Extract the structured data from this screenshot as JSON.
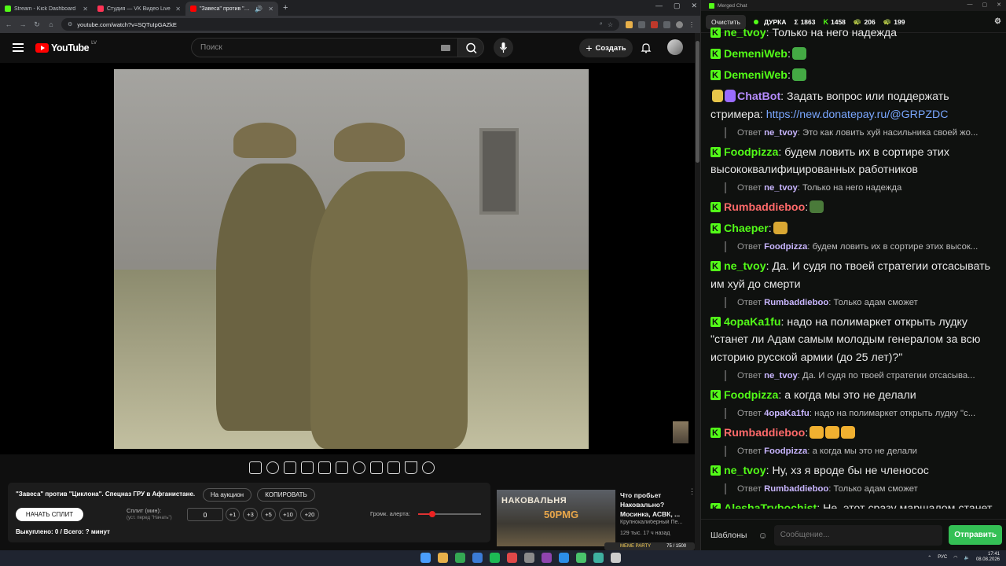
{
  "browser": {
    "tabs": [
      {
        "label": "Stream - Kick Dashboard",
        "color": "#53fc18",
        "active": false
      },
      {
        "label": "Студия — VK Видео Live",
        "color": "#ff3355",
        "active": false
      },
      {
        "label": "\"Завеса\" против \"Циклона\"...",
        "color": "#ff0000",
        "active": true
      }
    ],
    "url": "youtube.com/watch?v=SQTuIpGAZkE"
  },
  "youtube": {
    "logo_text": "YouTube",
    "country": "LV",
    "search_placeholder": "Поиск",
    "create_label": "Создать"
  },
  "panel": {
    "title": "\"Завеса\" против \"Циклона\". Спецназ ГРУ в Афганистане.",
    "auction_label": "На аукцион",
    "copy_label": "КОПИРОВАТЬ",
    "start_split_label": "НАЧАТЬ СПЛИТ",
    "split_label": "Сплит (мин):",
    "split_sub": "(уст. перед \"Начать\")",
    "split_value": "0",
    "steps": [
      "+1",
      "+3",
      "+5",
      "+10",
      "+20"
    ],
    "volume_label": "Громк. алерта:",
    "volume_level": 0.22,
    "bought": "Выкуплено: 0 / Всего: ? минут"
  },
  "recommendation": {
    "thumb_line1": "НАКОВАЛЬНЯ",
    "thumb_line2": "50PMG",
    "title": "Что пробьет Наковально? Мосинка, АСВК, ...",
    "channel": "Крупнокалиберный Пе...",
    "meta": "129 тыс.   17 ч назад"
  },
  "memebar": {
    "label": "MEME PARTY",
    "value": "75 / 1500"
  },
  "chat": {
    "window_title": "Merged Chat",
    "clear_label": "Очистить",
    "channel": "ДУРКА",
    "stats": [
      {
        "icon": "Σ",
        "value": "1863"
      },
      {
        "icon": "K",
        "value": "1458"
      },
      {
        "icon": "🐢",
        "value": "206"
      },
      {
        "icon": "🐢",
        "value": "199"
      }
    ],
    "messages": [
      {
        "user": "ne_tvoy",
        "color": "#53fc18",
        "text": ": Только на него надежда",
        "reply": null
      },
      {
        "user": "DemeniWeb",
        "color": "#53fc18",
        "text": ":",
        "emotes": [
          "#44aa44"
        ],
        "reply": null
      },
      {
        "user": "DemeniWeb",
        "color": "#53fc18",
        "text": ":",
        "emotes": [
          "#44aa44"
        ],
        "reply": null
      },
      {
        "user": "ChatBot",
        "color": "#b68cff",
        "bot": true,
        "text": ": Задать вопрос или поддержать стримера: ",
        "link": "https://new.donatepay.ru/@GRPZDC",
        "reply": {
          "label": "Ответ",
          "user": "ne_tvoy",
          "text": ": Это как ловить хуй насильника своей жо..."
        }
      },
      {
        "user": "Foodpizza",
        "color": "#53fc18",
        "text": ": будем ловить их в сортире этих высококвалифицированных работников",
        "reply": {
          "label": "Ответ",
          "user": "ne_tvoy",
          "text": ": Только на него надежда"
        }
      },
      {
        "user": "Rumbaddieboo",
        "color": "#ff6a6a",
        "text": ":",
        "emotes": [
          "#4a7a3a"
        ],
        "reply": null
      },
      {
        "user": "Chaeper",
        "color": "#53fc18",
        "text": ":",
        "emotes": [
          "#d9a733"
        ],
        "reply": {
          "label": "Ответ",
          "user": "Foodpizza",
          "text": ": будем ловить их в сортире этих высок..."
        }
      },
      {
        "user": "ne_tvoy",
        "color": "#53fc18",
        "text": ": Да. И судя по твоей стратегии отсасывать им хуй до смерти",
        "reply": {
          "label": "Ответ",
          "user": "Rumbaddieboo",
          "text": ": Только адам сможет"
        }
      },
      {
        "user": "4opaKa1fu",
        "color": "#53fc18",
        "text": ": надо на полимаркет открыть лудку \"станет ли Адам самым молодым генералом за всю историю русской армии (до 25 лет)?\"",
        "reply": {
          "label": "Ответ",
          "user": "ne_tvoy",
          "text": ": Да. И судя по твоей стратегии отсасыва..."
        }
      },
      {
        "user": "Foodpizza",
        "color": "#53fc18",
        "text": ": а когда мы это не делали",
        "reply": {
          "label": "Ответ",
          "user": "4opaKa1fu",
          "text": ": надо на полимаркет открыть лудку \"с..."
        }
      },
      {
        "user": "Rumbaddieboo",
        "color": "#ff6a6a",
        "text": ":",
        "emotes": [
          "#f0b030",
          "#f0b030",
          "#f0b030"
        ],
        "reply": {
          "label": "Ответ",
          "user": "Foodpizza",
          "text": ": а когда мы это не делали"
        }
      },
      {
        "user": "ne_tvoy",
        "color": "#53fc18",
        "text": ": Ну, хз я вроде бы не членосос",
        "reply": {
          "label": "Ответ",
          "user": "Rumbaddieboo",
          "text": ": Только адам сможет"
        }
      },
      {
        "user": "AleshaTrybochist",
        "color": "#53fc18",
        "text": ": Не, этот сразу маршалом станет",
        "reply": null
      }
    ],
    "templates_label": "Шаблоны",
    "input_placeholder": "Сообщение...",
    "send_label": "Отправить"
  },
  "taskbar": {
    "lang": "РУС",
    "time": "17:41",
    "date": "08.08.2026",
    "icons": [
      "#4a9eff",
      "#e8b04a",
      "#34a853",
      "#3b7bd6",
      "#1db954",
      "#e04848",
      "#8a8a8a",
      "#8e44ad",
      "#2c8ee8",
      "#4ac26b",
      "#3fb0a0",
      "#cccccc"
    ]
  }
}
